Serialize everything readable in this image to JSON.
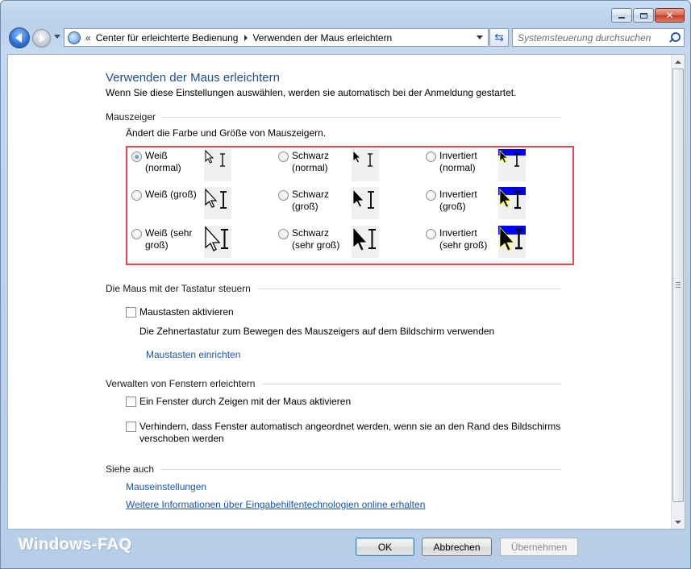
{
  "window": {
    "caption_buttons": {
      "minimize": "minimize-icon",
      "maximize": "maximize-icon",
      "close": "close-icon"
    }
  },
  "navbar": {
    "breadcrumb_chevron": "«",
    "breadcrumb": [
      "Center für erleichterte Bedienung",
      "Verwenden der Maus erleichtern"
    ],
    "search_placeholder": "Systemsteuerung durchsuchen"
  },
  "page": {
    "title": "Verwenden der Maus erleichtern",
    "subtitle": "Wenn Sie diese Einstellungen auswählen, werden sie automatisch bei der Anmeldung gestartet."
  },
  "mouse_pointers": {
    "heading": "Mauszeiger",
    "description": "Ändert die Farbe und Größe von Mauszeigern.",
    "options": [
      {
        "label": "Weiß\n(normal)",
        "style": "white",
        "size": "normal",
        "checked": true
      },
      {
        "label": "Schwarz\n(normal)",
        "style": "black",
        "size": "normal",
        "checked": false
      },
      {
        "label": "Invertiert\n(normal)",
        "style": "inverted",
        "size": "normal",
        "checked": false
      },
      {
        "label": "Weiß (groß)",
        "style": "white",
        "size": "large",
        "checked": false
      },
      {
        "label": "Schwarz\n(groß)",
        "style": "black",
        "size": "large",
        "checked": false
      },
      {
        "label": "Invertiert\n(groß)",
        "style": "inverted",
        "size": "large",
        "checked": false
      },
      {
        "label": "Weiß (sehr\ngroß)",
        "style": "white",
        "size": "xlarge",
        "checked": false
      },
      {
        "label": "Schwarz\n(sehr groß)",
        "style": "black",
        "size": "xlarge",
        "checked": false
      },
      {
        "label": "Invertiert\n(sehr groß)",
        "style": "inverted",
        "size": "xlarge",
        "checked": false
      }
    ]
  },
  "keyboard": {
    "heading": "Die Maus mit der Tastatur steuern",
    "mousekeys_label": "Maustasten aktivieren",
    "mousekeys_checked": false,
    "mousekeys_description": "Die Zehnertastatur zum Bewegen des Mauszeigers auf dem Bildschirm verwenden",
    "setup_link": "Maustasten einrichten"
  },
  "windows": {
    "heading": "Verwalten von Fenstern erleichtern",
    "hover_activate_label": "Ein Fenster durch Zeigen mit der Maus aktivieren",
    "hover_activate_checked": false,
    "prevent_arrange_label": "Verhindern, dass Fenster automatisch angeordnet werden, wenn sie an den Rand des Bildschirms verschoben werden",
    "prevent_arrange_checked": false
  },
  "see_also": {
    "heading": "Siehe auch",
    "links": [
      "Mauseinstellungen",
      "Weitere Informationen über Eingabehilfentechnologien online erhalten"
    ]
  },
  "footer": {
    "watermark": "Windows-FAQ",
    "ok": "OK",
    "cancel": "Abbrechen",
    "apply": "Übernehmen"
  },
  "colors": {
    "title_blue": "#1e4e9a",
    "link_blue": "#1a55b0",
    "highlight_red": "#e04a4a",
    "inverted_band": "#0000ff"
  }
}
